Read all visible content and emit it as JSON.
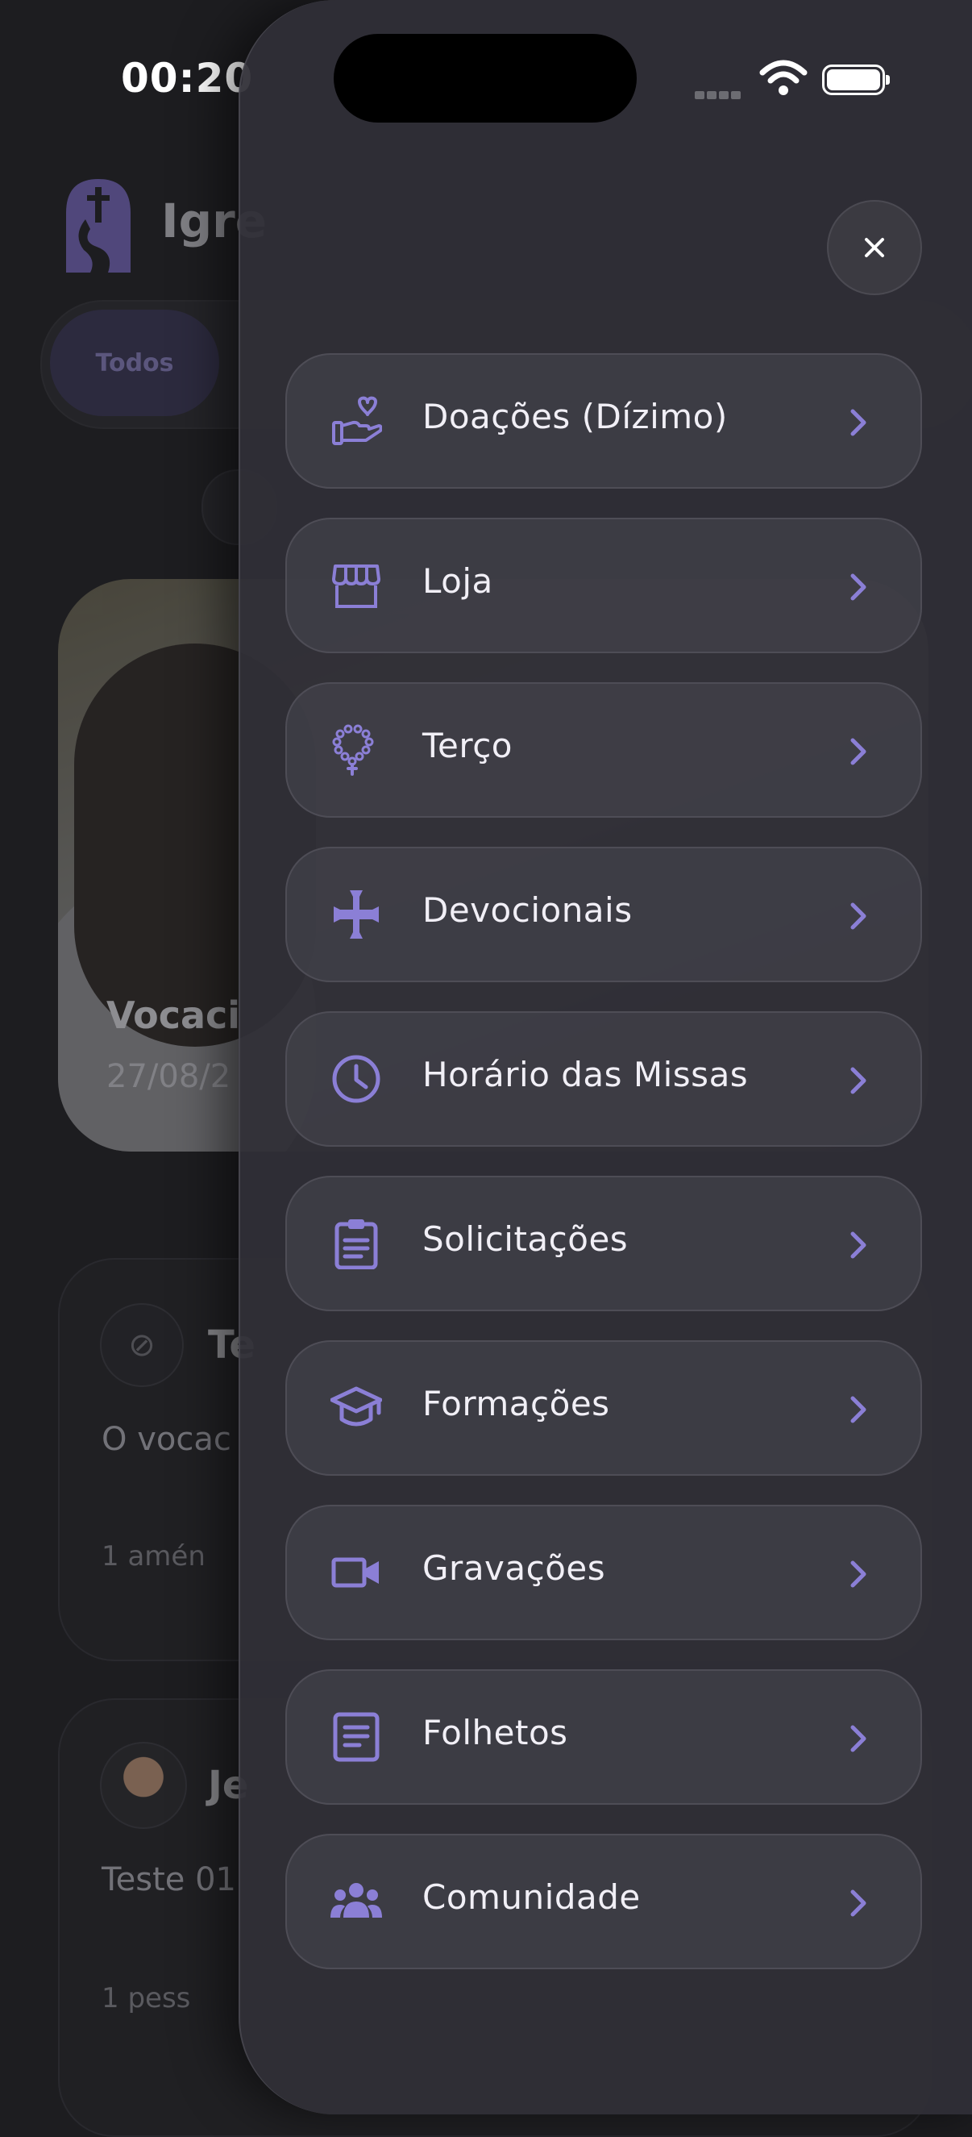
{
  "status_bar": {
    "time": "00:20"
  },
  "background": {
    "app_title": "Igre",
    "filter_active": "Todos",
    "featured": {
      "title": "Vocaci",
      "date": "27/08/2"
    },
    "posts": [
      {
        "author": "Te",
        "text": "O vocac",
        "meta": "1 amén"
      },
      {
        "author": "Je",
        "text": "Teste 01",
        "meta": "1 pess"
      }
    ]
  },
  "drawer": {
    "accent_color": "#8b7fd6",
    "menu": [
      {
        "label": "Doações (Dízimo)",
        "icon": "hand-heart-icon"
      },
      {
        "label": "Loja",
        "icon": "store-icon"
      },
      {
        "label": "Terço",
        "icon": "rosary-icon"
      },
      {
        "label": "Devocionais",
        "icon": "cross-icon"
      },
      {
        "label": "Horário das Missas",
        "icon": "clock-icon"
      },
      {
        "label": "Solicitações",
        "icon": "clipboard-icon"
      },
      {
        "label": "Formações",
        "icon": "graduation-cap-icon"
      },
      {
        "label": "Gravações",
        "icon": "video-camera-icon"
      },
      {
        "label": "Folhetos",
        "icon": "document-icon"
      },
      {
        "label": "Comunidade",
        "icon": "community-icon"
      }
    ]
  }
}
